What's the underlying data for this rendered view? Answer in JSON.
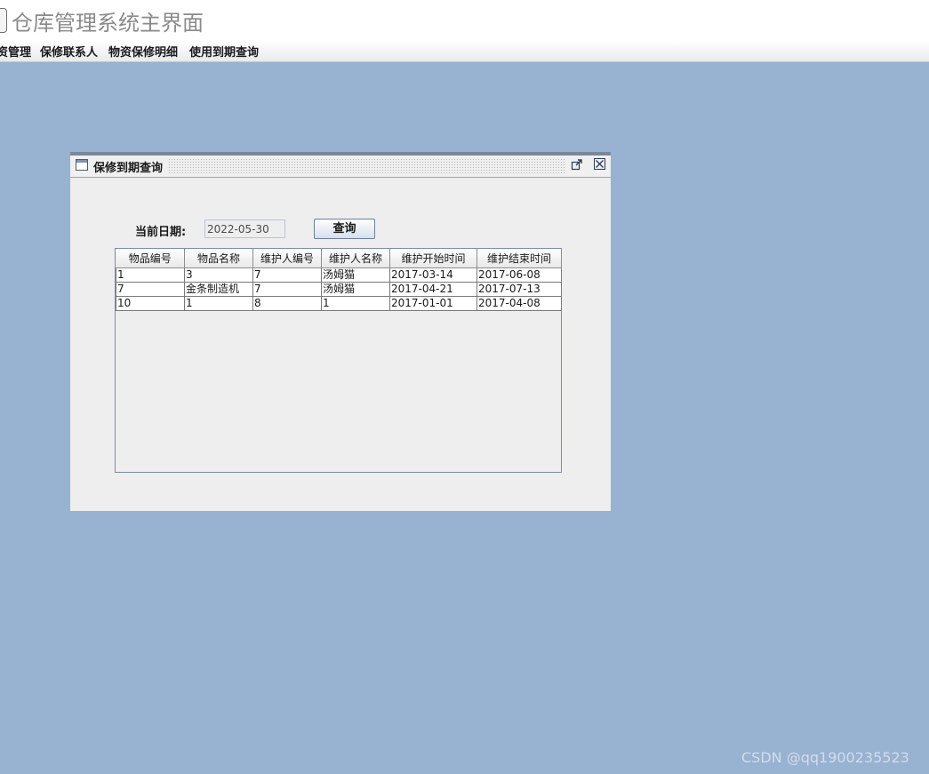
{
  "app": {
    "title": "仓库管理系统主界面"
  },
  "menubar": {
    "items": [
      {
        "label": "资管理"
      },
      {
        "label": "保修联系人"
      },
      {
        "label": "物资保修明细"
      },
      {
        "label": "使用到期查询"
      }
    ]
  },
  "internal_frame": {
    "title": "保修到期查询",
    "date_label": "当前日期:",
    "date_value": "2022-05-30",
    "query_button": "查询"
  },
  "table": {
    "columns": [
      "物品编号",
      "物品名称",
      "维护人编号",
      "维护人名称",
      "维护开始时间",
      "维护结束时间"
    ],
    "rows": [
      [
        "1",
        "3",
        "7",
        "汤姆猫",
        "2017-03-14",
        "2017-06-08"
      ],
      [
        "7",
        "金条制造机",
        "7",
        "汤姆猫",
        "2017-04-21",
        "2017-07-13"
      ],
      [
        "10",
        "1",
        "8",
        "1",
        "2017-01-01",
        "2017-04-08"
      ]
    ]
  },
  "watermark": "CSDN @qq1900235523",
  "colors": {
    "desktop_background": "#98b2d1",
    "frame_background": "#eeeeee"
  }
}
